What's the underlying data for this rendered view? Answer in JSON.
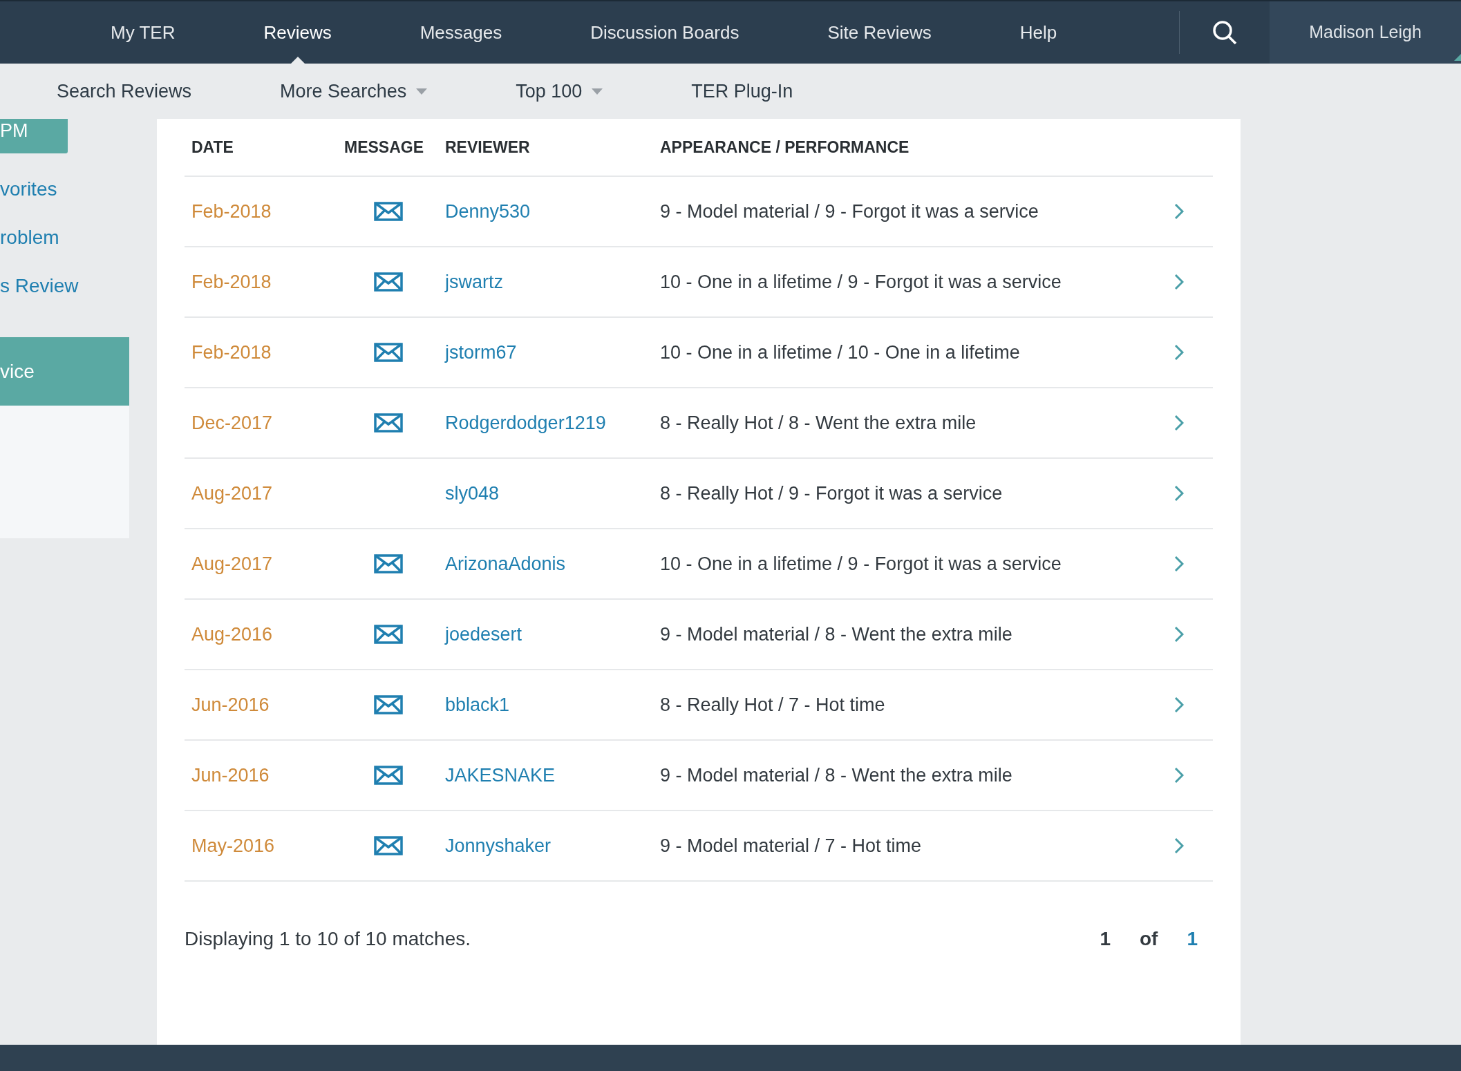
{
  "top_nav": {
    "items": [
      {
        "label": "My TER",
        "selected": false
      },
      {
        "label": "Reviews",
        "selected": true
      },
      {
        "label": "Messages",
        "selected": false
      },
      {
        "label": "Discussion Boards",
        "selected": false
      },
      {
        "label": "Site Reviews",
        "selected": false
      },
      {
        "label": "Help",
        "selected": false
      }
    ],
    "user": "Madison Leigh"
  },
  "sub_nav": [
    {
      "label": "Search Reviews",
      "dropdown": false
    },
    {
      "label": "More Searches",
      "dropdown": true
    },
    {
      "label": "Top 100",
      "dropdown": true
    },
    {
      "label": "TER Plug-In",
      "dropdown": false
    }
  ],
  "sidebar": {
    "button": "PM",
    "links": [
      "vorites",
      "roblem",
      "s Review"
    ],
    "active_item": "vice"
  },
  "table": {
    "columns": [
      "DATE",
      "MESSAGE",
      "REVIEWER",
      "APPEARANCE / PERFORMANCE"
    ],
    "rows": [
      {
        "date": "Feb-2018",
        "message": true,
        "reviewer": "Denny530",
        "rating": "9 - Model material / 9 - Forgot it was a service"
      },
      {
        "date": "Feb-2018",
        "message": true,
        "reviewer": "jswartz",
        "rating": "10 - One in a lifetime / 9 - Forgot it was a service"
      },
      {
        "date": "Feb-2018",
        "message": true,
        "reviewer": "jstorm67",
        "rating": "10 - One in a lifetime / 10 - One in a lifetime"
      },
      {
        "date": "Dec-2017",
        "message": true,
        "reviewer": "Rodgerdodger1219",
        "rating": "8 - Really Hot / 8 - Went the extra mile"
      },
      {
        "date": "Aug-2017",
        "message": false,
        "reviewer": "sly048",
        "rating": "8 - Really Hot / 9 - Forgot it was a service"
      },
      {
        "date": "Aug-2017",
        "message": true,
        "reviewer": "ArizonaAdonis",
        "rating": "10 - One in a lifetime / 9 - Forgot it was a service"
      },
      {
        "date": "Aug-2016",
        "message": true,
        "reviewer": "joedesert",
        "rating": "9 - Model material / 8 - Went the extra mile"
      },
      {
        "date": "Jun-2016",
        "message": true,
        "reviewer": "bblack1",
        "rating": "8 - Really Hot / 7 - Hot time"
      },
      {
        "date": "Jun-2016",
        "message": true,
        "reviewer": "JAKESNAKE",
        "rating": "9 - Model material / 8 - Went the extra mile"
      },
      {
        "date": "May-2016",
        "message": true,
        "reviewer": "Jonnyshaker",
        "rating": "9 - Model material / 7 - Hot time"
      }
    ]
  },
  "footer": {
    "summary": "Displaying 1 to 10 of 10 matches.",
    "pagination": {
      "current": "1",
      "of": "of",
      "total": "1"
    }
  }
}
